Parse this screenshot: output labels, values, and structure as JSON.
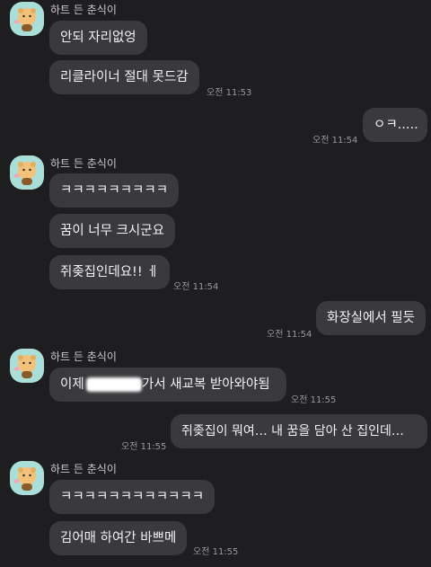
{
  "sender_name": "하트 든 춘식이",
  "groups": [
    {
      "messages": [
        {
          "text": "안되 자리없엉",
          "time": ""
        },
        {
          "text": "리클라이너 절대 못드감",
          "time": "오전 11:53"
        }
      ]
    },
    {
      "messages": [
        {
          "text": "ㅋㅋㅋㅋㅋㅋㅋㅋㅋ",
          "time": ""
        },
        {
          "text": "꿈이 너무 크시군요",
          "time": ""
        },
        {
          "text": "쥐좆집인데요!! ㅔ",
          "time": "오전 11:54"
        }
      ]
    },
    {
      "messages": [
        {
          "text_before": "이제",
          "text_after": "가서 새교복 받아와야됨",
          "time": "오전 11:55"
        }
      ]
    },
    {
      "messages": [
        {
          "text": "ㅋㅋㅋㅋㅋㅋㅋㅋㅋㅋㅋㅋ",
          "time": ""
        },
        {
          "text": "김어매 하여간 바쁘메",
          "time": "오전 11:55"
        }
      ]
    }
  ],
  "my_messages": [
    {
      "text": "ㅇㅋ.....",
      "time": "오전 11:54"
    },
    {
      "text": "화장실에서 필듯",
      "time": "오전 11:54"
    },
    {
      "text": "쥐좆집이 뭐여… 내 꿈을 담아 산 집인데…",
      "time": "오전 11:55"
    }
  ],
  "colors": {
    "background": "#1e1e21",
    "bubble": "#3a3a3e",
    "avatar_bg": "#a9dfd8",
    "timestamp": "#9a9a9e"
  },
  "icons": {
    "avatar": "choonsik-holding-heart-avatar"
  }
}
